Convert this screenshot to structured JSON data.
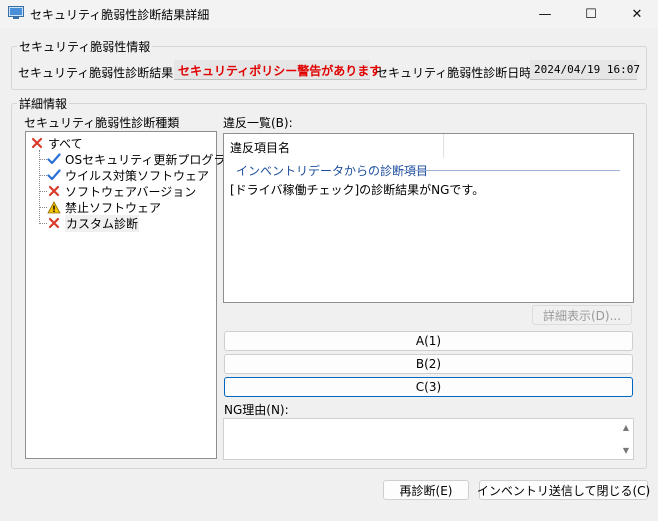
{
  "window": {
    "title": "セキュリティ脆弱性診断結果詳細",
    "minimize": "—",
    "maximize": "☐",
    "close": "✕"
  },
  "info_group": {
    "title": "セキュリティ脆弱性情報",
    "result_label": "セキュリティ脆弱性診断結果(R):",
    "result_value": "セキュリティポリシー警告があります",
    "datetime_label": "セキュリティ脆弱性診断日時(T):",
    "datetime_value": "2024/04/19 16:07"
  },
  "detail_group": {
    "title": "詳細情報",
    "tree_label": "セキュリティ脆弱性診断種類",
    "tree": [
      {
        "label": "すべて",
        "icon": "x-icon"
      },
      {
        "label": "OSセキュリティ更新プログラム",
        "icon": "check-icon"
      },
      {
        "label": "ウイルス対策ソフトウェア",
        "icon": "check-icon"
      },
      {
        "label": "ソフトウェアバージョン",
        "icon": "x-icon"
      },
      {
        "label": "禁止ソフトウェア",
        "icon": "warning-icon"
      },
      {
        "label": "カスタム診断",
        "icon": "x-icon"
      }
    ],
    "violation_label": "違反一覧(B):",
    "violation_column": "違反項目名",
    "violation_group": "インベントリデータからの診断項目",
    "violation_rows": [
      "[ドライバ稼働チェック]の診断結果がNGです。"
    ],
    "detail_button": "詳細表示(D)...",
    "option_a": "A(1)",
    "option_b": "B(2)",
    "option_c": "C(3)",
    "ng_reason_label": "NG理由(N):",
    "ng_reason_value": ""
  },
  "footer": {
    "rediagnose_button": "再診断(E)",
    "send_close_button": "インベントリ送信して閉じる(C)"
  },
  "colors": {
    "warning_text": "#e00000",
    "check": "#2a6fd6",
    "x_mark": "#d83b2b",
    "group_header": "#1e4e9c",
    "focus_border": "#0067c0"
  }
}
